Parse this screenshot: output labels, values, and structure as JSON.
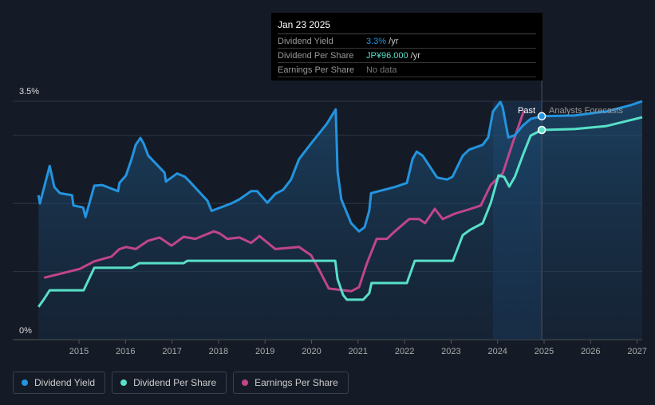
{
  "chart_data": {
    "type": "line",
    "y_axis_labels": [
      "3.5%",
      "0%"
    ],
    "ylim": [
      0,
      3.5
    ],
    "xlim": [
      2014.1,
      2027.2
    ],
    "x_ticks": [
      "2015",
      "2016",
      "2017",
      "2018",
      "2019",
      "2020",
      "2021",
      "2022",
      "2023",
      "2024",
      "2025",
      "2026",
      "2027"
    ],
    "annotations": {
      "past": "Past",
      "forecast": "Analysts Forecasts"
    },
    "hover_x": 2024.95,
    "past_region_start": 2023.9,
    "series": [
      {
        "name": "Dividend Yield",
        "color": "#2394df",
        "unit": "%",
        "points": [
          [
            2014.13,
            2.12
          ],
          [
            2014.16,
            2.0
          ],
          [
            2014.37,
            2.55
          ],
          [
            2014.47,
            2.24
          ],
          [
            2014.59,
            2.15
          ],
          [
            2014.85,
            2.12
          ],
          [
            2014.88,
            1.97
          ],
          [
            2015.09,
            1.94
          ],
          [
            2015.14,
            1.8
          ],
          [
            2015.33,
            2.26
          ],
          [
            2015.5,
            2.27
          ],
          [
            2015.84,
            2.18
          ],
          [
            2015.87,
            2.3
          ],
          [
            2016.01,
            2.41
          ],
          [
            2016.13,
            2.65
          ],
          [
            2016.22,
            2.86
          ],
          [
            2016.32,
            2.96
          ],
          [
            2016.39,
            2.88
          ],
          [
            2016.49,
            2.7
          ],
          [
            2016.73,
            2.53
          ],
          [
            2016.84,
            2.45
          ],
          [
            2016.87,
            2.32
          ],
          [
            2017.11,
            2.44
          ],
          [
            2017.28,
            2.39
          ],
          [
            2017.38,
            2.32
          ],
          [
            2017.76,
            2.04
          ],
          [
            2017.85,
            1.89
          ],
          [
            2018.28,
            2.0
          ],
          [
            2018.45,
            2.06
          ],
          [
            2018.7,
            2.18
          ],
          [
            2018.83,
            2.18
          ],
          [
            2019.05,
            2.01
          ],
          [
            2019.22,
            2.14
          ],
          [
            2019.39,
            2.2
          ],
          [
            2019.56,
            2.35
          ],
          [
            2019.73,
            2.65
          ],
          [
            2019.99,
            2.88
          ],
          [
            2020.33,
            3.17
          ],
          [
            2020.52,
            3.38
          ],
          [
            2020.56,
            2.47
          ],
          [
            2020.64,
            2.06
          ],
          [
            2020.85,
            1.71
          ],
          [
            2021.02,
            1.59
          ],
          [
            2021.14,
            1.65
          ],
          [
            2021.24,
            1.89
          ],
          [
            2021.28,
            2.15
          ],
          [
            2021.79,
            2.24
          ],
          [
            2022.05,
            2.3
          ],
          [
            2022.17,
            2.65
          ],
          [
            2022.26,
            2.76
          ],
          [
            2022.39,
            2.7
          ],
          [
            2022.7,
            2.38
          ],
          [
            2022.91,
            2.35
          ],
          [
            2023.03,
            2.39
          ],
          [
            2023.25,
            2.7
          ],
          [
            2023.39,
            2.79
          ],
          [
            2023.68,
            2.86
          ],
          [
            2023.8,
            2.97
          ],
          [
            2023.9,
            3.35
          ],
          [
            2024.06,
            3.49
          ],
          [
            2024.11,
            3.41
          ],
          [
            2024.23,
            2.97
          ],
          [
            2024.37,
            3.0
          ],
          [
            2024.54,
            3.14
          ],
          [
            2024.71,
            3.24
          ],
          [
            2024.95,
            3.28
          ],
          [
            2025.65,
            3.29
          ],
          [
            2026.34,
            3.35
          ],
          [
            2026.85,
            3.44
          ],
          [
            2027.11,
            3.5
          ]
        ]
      },
      {
        "name": "Dividend Per Share",
        "color": "#58e0c8",
        "unit": "JPY",
        "points": [
          [
            2014.13,
            15.0
          ],
          [
            2014.25,
            18.6
          ],
          [
            2014.37,
            22.6
          ],
          [
            2015.1,
            22.6
          ],
          [
            2015.33,
            32.9
          ],
          [
            2016.13,
            32.9
          ],
          [
            2016.3,
            35.0
          ],
          [
            2017.25,
            35.0
          ],
          [
            2017.33,
            36.1
          ],
          [
            2020.51,
            36.1
          ],
          [
            2020.56,
            27.7
          ],
          [
            2020.68,
            20.4
          ],
          [
            2020.76,
            18.3
          ],
          [
            2021.11,
            18.3
          ],
          [
            2021.24,
            21.2
          ],
          [
            2021.29,
            25.9
          ],
          [
            2022.05,
            25.9
          ],
          [
            2022.22,
            36.1
          ],
          [
            2023.04,
            36.1
          ],
          [
            2023.25,
            47.8
          ],
          [
            2023.42,
            50.4
          ],
          [
            2023.68,
            53.3
          ],
          [
            2023.85,
            62.4
          ],
          [
            2024.02,
            75.2
          ],
          [
            2024.14,
            74.5
          ],
          [
            2024.25,
            70.1
          ],
          [
            2024.37,
            74.5
          ],
          [
            2024.54,
            84.3
          ],
          [
            2024.71,
            93.4
          ],
          [
            2024.95,
            96.0
          ],
          [
            2025.65,
            96.4
          ],
          [
            2026.34,
            97.8
          ],
          [
            2027.11,
            101.8
          ]
        ]
      },
      {
        "name": "Earnings Per Share",
        "color": "#c0458a",
        "unit": "relative",
        "points": [
          [
            2014.25,
            0.91
          ],
          [
            2014.5,
            0.95
          ],
          [
            2015.02,
            1.04
          ],
          [
            2015.33,
            1.15
          ],
          [
            2015.7,
            1.22
          ],
          [
            2015.87,
            1.33
          ],
          [
            2016.01,
            1.36
          ],
          [
            2016.22,
            1.33
          ],
          [
            2016.48,
            1.45
          ],
          [
            2016.73,
            1.5
          ],
          [
            2016.99,
            1.38
          ],
          [
            2017.25,
            1.51
          ],
          [
            2017.5,
            1.48
          ],
          [
            2017.9,
            1.59
          ],
          [
            2018.02,
            1.56
          ],
          [
            2018.19,
            1.48
          ],
          [
            2018.45,
            1.5
          ],
          [
            2018.7,
            1.42
          ],
          [
            2018.88,
            1.52
          ],
          [
            2019.22,
            1.33
          ],
          [
            2019.73,
            1.36
          ],
          [
            2019.99,
            1.24
          ],
          [
            2020.16,
            1.03
          ],
          [
            2020.37,
            0.75
          ],
          [
            2020.85,
            0.71
          ],
          [
            2021.02,
            0.77
          ],
          [
            2021.19,
            1.12
          ],
          [
            2021.4,
            1.48
          ],
          [
            2021.62,
            1.48
          ],
          [
            2021.79,
            1.59
          ],
          [
            2022.1,
            1.77
          ],
          [
            2022.31,
            1.77
          ],
          [
            2022.44,
            1.71
          ],
          [
            2022.65,
            1.92
          ],
          [
            2022.82,
            1.77
          ],
          [
            2023.08,
            1.85
          ],
          [
            2023.42,
            1.92
          ],
          [
            2023.64,
            1.97
          ],
          [
            2023.85,
            2.27
          ],
          [
            2024.11,
            2.44
          ],
          [
            2024.32,
            2.88
          ],
          [
            2024.57,
            3.37
          ]
        ]
      }
    ]
  },
  "tooltip": {
    "date": "Jan 23 2025",
    "rows": [
      {
        "label": "Dividend Yield",
        "value": "3.3%",
        "suffix": " /yr",
        "color": "#2394df"
      },
      {
        "label": "Dividend Per Share",
        "value": "JP¥96.000",
        "suffix": " /yr",
        "color": "#58e0c8"
      },
      {
        "label": "Earnings Per Share",
        "value": "No data",
        "suffix": "",
        "color": "#777777"
      }
    ]
  },
  "legend": [
    {
      "label": "Dividend Yield",
      "color": "#2394df"
    },
    {
      "label": "Dividend Per Share",
      "color": "#58e0c8"
    },
    {
      "label": "Earnings Per Share",
      "color": "#c0458a"
    }
  ]
}
